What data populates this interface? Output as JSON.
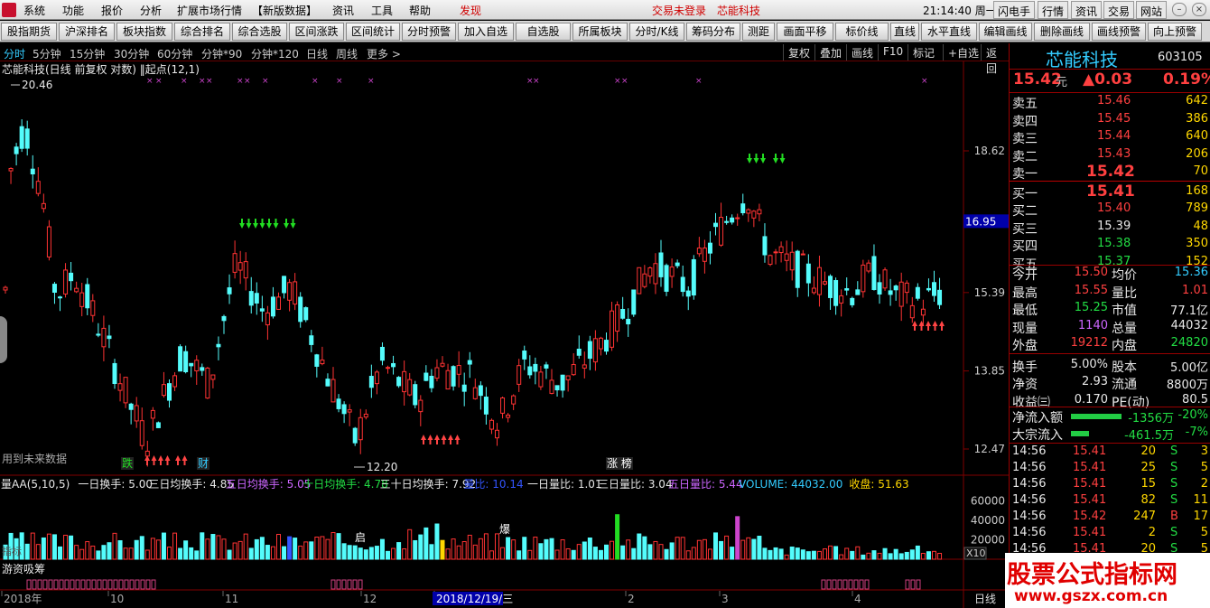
{
  "menubar": {
    "items": [
      "系统",
      "功能",
      "报价",
      "分析",
      "扩展市场行情",
      "【新版数据】",
      "资讯",
      "工具",
      "帮助",
      "发现"
    ],
    "login": "交易未登录",
    "stock": "芯能科技",
    "clock": "21:14:40 周一",
    "buttons": [
      "闪电手",
      "行情",
      "资讯",
      "交易",
      "网站"
    ]
  },
  "toolbar": {
    "buttons": [
      "股指期货",
      "沪深排名",
      "板块指数",
      "综合排名",
      "综合选股",
      "区间涨跌",
      "区间统计",
      "分时预警",
      "加入自选",
      "自选股",
      "所属板块",
      "分时/K线",
      "筹码分布",
      "测距",
      "画面平移",
      "标价线",
      "直线",
      "水平直线",
      "编辑画线",
      "删除画线",
      "画线预警",
      "向上预警"
    ]
  },
  "periods": {
    "items": [
      "分时",
      "5分钟",
      "15分钟",
      "30分钟",
      "60分钟",
      "分钟*90",
      "分钟*120",
      "日线",
      "周线",
      "更多 >"
    ],
    "right": [
      "复权",
      "叠加",
      "画线",
      "F10",
      "标记",
      "+自选",
      "返回"
    ]
  },
  "chart": {
    "title": "芯能科技(日线 前复权 对数) ‖起点(12,1)",
    "high_label": "20.46",
    "low_label": "12.20",
    "price_tag": "16.95",
    "y_ticks": [
      "18.62",
      "16.95",
      "15.39",
      "13.85",
      "12.47"
    ],
    "note": "用到未来数据",
    "badges": [
      "跌",
      "财",
      "涨 榜"
    ],
    "vol_header": [
      {
        "t": "量AA(5,10,5)",
        "c": "#e8e8e8"
      },
      {
        "t": "一日换手: 5.00",
        "c": "#e8e8e8"
      },
      {
        "t": "三日均换手: 4.85",
        "c": "#e8e8e8"
      },
      {
        "t": "五日均换手: 5.05",
        "c": "#cc66ff"
      },
      {
        "t": "十日均换手: 4.78",
        "c": "#22dd44"
      },
      {
        "t": "三十日均换手: 7.92",
        "c": "#e8e8e8"
      },
      {
        "t": "量比: 10.14",
        "c": "#3355ff"
      },
      {
        "t": "一日量比: 1.01",
        "c": "#e8e8e8"
      },
      {
        "t": "三日量比: 3.04",
        "c": "#e8e8e8"
      },
      {
        "t": "五日量比: 5.44",
        "c": "#cc66ff"
      },
      {
        "t": "VOLUME: 44032.00",
        "c": "#33ccff"
      },
      {
        "t": "收盘: 51.63",
        "c": "#ffd700"
      }
    ],
    "vol_ticks": [
      "60000",
      "40000",
      "20000"
    ],
    "x10": "X10",
    "vol_markers": [
      "启",
      "爆"
    ],
    "vol_left": "指标",
    "sub_title": "游资吸筹",
    "date_axis": [
      "2018年",
      "10",
      "11",
      "12",
      "2018/12/19/三",
      "2",
      "3",
      "4"
    ],
    "period_label": "日线"
  },
  "quote": {
    "name": "芯能科技",
    "code": "603105",
    "price": "15.42",
    "unit": "元",
    "change": "▲0.03",
    "pct": "0.19%",
    "asks": [
      {
        "label": "卖五",
        "price": "15.46",
        "vol": "642"
      },
      {
        "label": "卖四",
        "price": "15.45",
        "vol": "386"
      },
      {
        "label": "卖三",
        "price": "15.44",
        "vol": "640"
      },
      {
        "label": "卖二",
        "price": "15.43",
        "vol": "206"
      },
      {
        "label": "卖一",
        "price": "15.42",
        "vol": "70"
      }
    ],
    "bids": [
      {
        "label": "买一",
        "price": "15.41",
        "vol": "168"
      },
      {
        "label": "买二",
        "price": "15.40",
        "vol": "789"
      },
      {
        "label": "买三",
        "price": "15.39",
        "vol": "48"
      },
      {
        "label": "买四",
        "price": "15.38",
        "vol": "350"
      },
      {
        "label": "买五",
        "price": "15.37",
        "vol": "152"
      }
    ],
    "stats": [
      [
        "今开",
        "15.50",
        "均价",
        "15.36"
      ],
      [
        "最高",
        "15.55",
        "量比",
        "1.01"
      ],
      [
        "最低",
        "15.25",
        "市值",
        "77.1亿"
      ],
      [
        "现量",
        "1140",
        "总量",
        "44032"
      ],
      [
        "外盘",
        "19212",
        "内盘",
        "24820"
      ],
      [
        "换手",
        "5.00%",
        "股本",
        "5.00亿"
      ],
      [
        "净资",
        "2.93",
        "流通",
        "8800万"
      ],
      [
        "收益㈢",
        "0.170",
        "PE(动)",
        "80.5"
      ]
    ],
    "flows": [
      {
        "label": "净流入额",
        "value": "-1356万",
        "pct": "-20%",
        "bar": 0.2
      },
      {
        "label": "大宗流入",
        "value": "-461.5万",
        "pct": "-7%",
        "bar": 0.07
      }
    ],
    "ticks": [
      [
        "14:56",
        "15.41",
        "20",
        "S",
        "3"
      ],
      [
        "14:56",
        "15.41",
        "25",
        "S",
        "5"
      ],
      [
        "14:56",
        "15.41",
        "15",
        "S",
        "2"
      ],
      [
        "14:56",
        "15.41",
        "82",
        "S",
        "11"
      ],
      [
        "14:56",
        "15.42",
        "247",
        "B",
        "17"
      ],
      [
        "14:56",
        "15.41",
        "2",
        "S",
        "5"
      ],
      [
        "14:56",
        "15.41",
        "20",
        "S",
        "5"
      ]
    ]
  },
  "watermark": {
    "line1": "股票公式指标网",
    "line2": "www.gszx.com.cn"
  },
  "colors": {
    "up": "#ff3333",
    "down": "#54fcfc",
    "bg": "#000000",
    "grid": "#800000"
  }
}
